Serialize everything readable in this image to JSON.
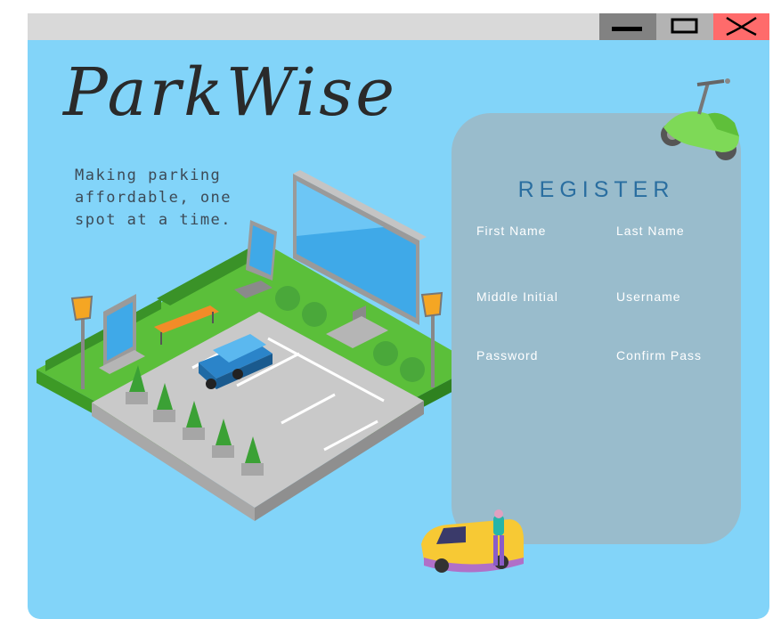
{
  "app": {
    "logo_text": "ParkWise",
    "tagline_lines": [
      "Making parking",
      "affordable, one",
      "spot at a time."
    ]
  },
  "window_controls": {
    "minimize_icon": "minimize-icon",
    "maximize_icon": "maximize-icon",
    "close_icon": "close-icon"
  },
  "register": {
    "title": "REGISTER",
    "fields": {
      "first_name": "First Name",
      "last_name": "Last Name",
      "middle_initial": "Middle Initial",
      "username": "Username",
      "password": "Password",
      "confirm_pass": "Confirm Pass"
    }
  },
  "colors": {
    "background": "#82d4f9",
    "panel": "#99bccc",
    "title": "#2a6ea0",
    "close": "#ff6b6b"
  }
}
